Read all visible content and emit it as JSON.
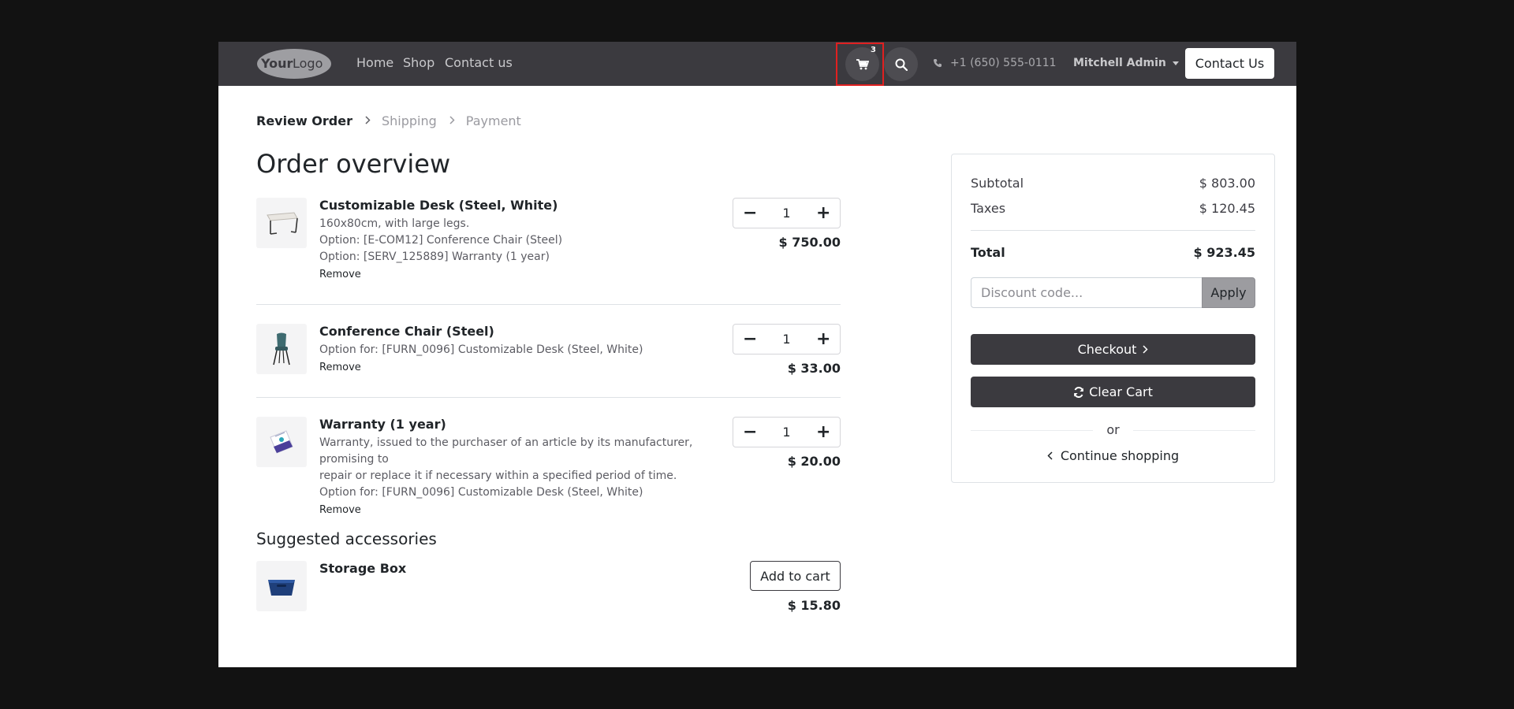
{
  "navbar": {
    "logo_text_bold": "Your",
    "logo_text_light": "Logo",
    "links": [
      {
        "label": "Home"
      },
      {
        "label": "Shop"
      },
      {
        "label": "Contact us"
      }
    ],
    "cart_count": "3",
    "phone": "+1 (650) 555-0111",
    "user_name": "Mitchell Admin",
    "contact_button": "Contact Us"
  },
  "breadcrumb": {
    "step1": "Review Order",
    "step2": "Shipping",
    "step3": "Payment"
  },
  "page_title": "Order overview",
  "cart_items": [
    {
      "name": "Customizable Desk (Steel, White)",
      "lines": [
        "160x80cm, with large legs.",
        "Option: [E-COM12] Conference Chair (Steel)",
        "Option: [SERV_125889] Warranty (1 year)"
      ],
      "remove": "Remove",
      "qty": "1",
      "price": "$ 750.00"
    },
    {
      "name": "Conference Chair (Steel)",
      "lines": [
        "Option for: [FURN_0096] Customizable Desk (Steel, White)"
      ],
      "remove": "Remove",
      "qty": "1",
      "price": "$ 33.00"
    },
    {
      "name": "Warranty (1 year)",
      "lines": [
        "Warranty, issued to the purchaser of an article by its manufacturer, promising to",
        "repair or replace it if necessary within a specified period of time.",
        "Option for: [FURN_0096] Customizable Desk (Steel, White)"
      ],
      "remove": "Remove",
      "qty": "1",
      "price": "$ 20.00"
    }
  ],
  "suggested": {
    "title": "Suggested accessories",
    "items": [
      {
        "name": "Storage Box",
        "button": "Add to cart",
        "price": "$ 15.80"
      }
    ]
  },
  "summary": {
    "subtotal_label": "Subtotal",
    "subtotal_value": "$ 803.00",
    "taxes_label": "Taxes",
    "taxes_value": "$ 120.45",
    "total_label": "Total",
    "total_value": "$ 923.45",
    "discount_placeholder": "Discount code...",
    "apply_label": "Apply",
    "checkout_label": "Checkout",
    "clear_label": "Clear Cart",
    "or_label": "or",
    "continue_label": "Continue shopping"
  },
  "icons": {
    "cart": "cart-icon",
    "search": "search-icon",
    "phone": "phone-icon",
    "refresh": "refresh-icon"
  },
  "colors": {
    "navbar": "#3b3a3f",
    "highlight": "#e02020",
    "button_dark": "#3b3a3f",
    "apply_button": "#9c9ca0"
  }
}
